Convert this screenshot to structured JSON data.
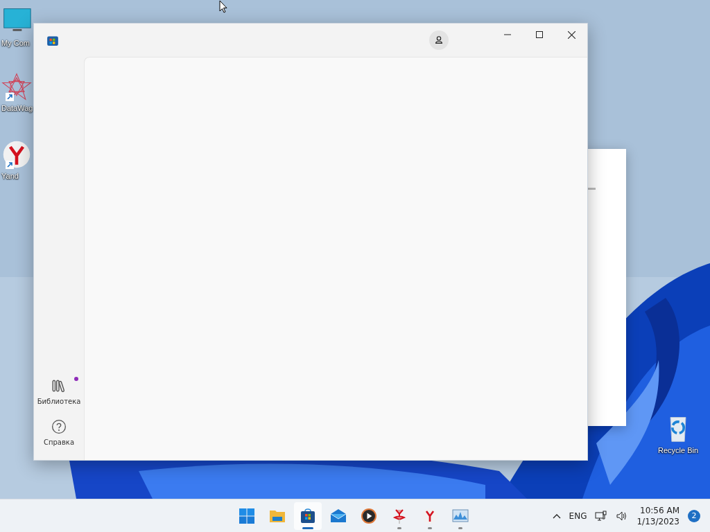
{
  "desktop": {
    "icons": [
      {
        "kind": "computer",
        "label": "My Com"
      },
      {
        "kind": "datawagon",
        "label": "DataWag",
        "shortcut": true
      },
      {
        "kind": "yandex",
        "label": "Yand",
        "shortcut": true
      },
      {
        "kind": "recycle",
        "label": "Recycle Bin"
      }
    ]
  },
  "window": {
    "sidebar": {
      "items": [
        {
          "kind": "library",
          "label": "Библиотека",
          "dot": true
        },
        {
          "kind": "help",
          "label": "Справка",
          "dot": false
        }
      ]
    }
  },
  "taskbar": {
    "apps": [
      {
        "kind": "start",
        "selected": false,
        "running": false
      },
      {
        "kind": "folder",
        "selected": false,
        "running": false
      },
      {
        "kind": "store",
        "selected": true,
        "running": true
      },
      {
        "kind": "mail",
        "selected": false,
        "running": false
      },
      {
        "kind": "player",
        "selected": false,
        "running": false
      },
      {
        "kind": "redapp",
        "selected": false,
        "running": true
      },
      {
        "kind": "yandex",
        "selected": false,
        "running": true
      },
      {
        "kind": "monitor",
        "selected": false,
        "running": true
      }
    ],
    "language": "ENG",
    "time": "10:56 AM",
    "date": "1/13/2023",
    "notifications": "2"
  }
}
